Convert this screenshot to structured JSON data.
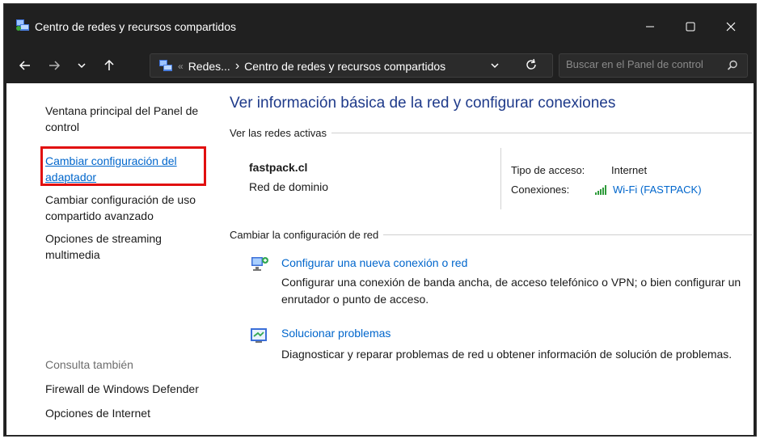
{
  "window": {
    "title": "Centro de redes y recursos compartidos",
    "minimize_label": "—",
    "maximize_label": "☐",
    "close_label": "✕"
  },
  "navbar": {
    "breadcrumb": {
      "prefix": "«",
      "parent": "Redes...",
      "separator": "›",
      "current": "Centro de redes y recursos compartidos"
    },
    "search_placeholder": "Buscar en el Panel de control"
  },
  "sidebar": {
    "links": [
      {
        "label": "Ventana principal del Panel de control"
      },
      {
        "label": "Cambiar configuración del adaptador"
      },
      {
        "label": "Cambiar configuración de uso compartido avanzado"
      },
      {
        "label": "Opciones de streaming multimedia"
      }
    ],
    "see_also_title": "Consulta también",
    "see_also": [
      {
        "label": "Firewall de Windows Defender"
      },
      {
        "label": "Opciones de Internet"
      }
    ]
  },
  "main": {
    "heading": "Ver información básica de la red y configurar conexiones",
    "active_networks_label": "Ver las redes activas",
    "network": {
      "name": "fastpack.cl",
      "type": "Red de dominio",
      "access_type_label": "Tipo de acceso:",
      "access_type_value": "Internet",
      "connections_label": "Conexiones:",
      "connection_value": "Wi-Fi (FASTPACK)"
    },
    "change_settings_label": "Cambiar la configuración de red",
    "tasks": [
      {
        "icon": "network-setup-icon",
        "title": "Configurar una nueva conexión o red",
        "description": "Configurar una conexión de banda ancha, de acceso telefónico o VPN; o bien configurar un enrutador o punto de acceso."
      },
      {
        "icon": "troubleshoot-icon",
        "title": "Solucionar problemas",
        "description": "Diagnosticar y reparar problemas de red u obtener información de solución de problemas."
      }
    ]
  },
  "colors": {
    "link": "#0066cc",
    "heading": "#1e3a8a",
    "highlight_box": "#e10f0f",
    "titlebar": "#202020"
  }
}
